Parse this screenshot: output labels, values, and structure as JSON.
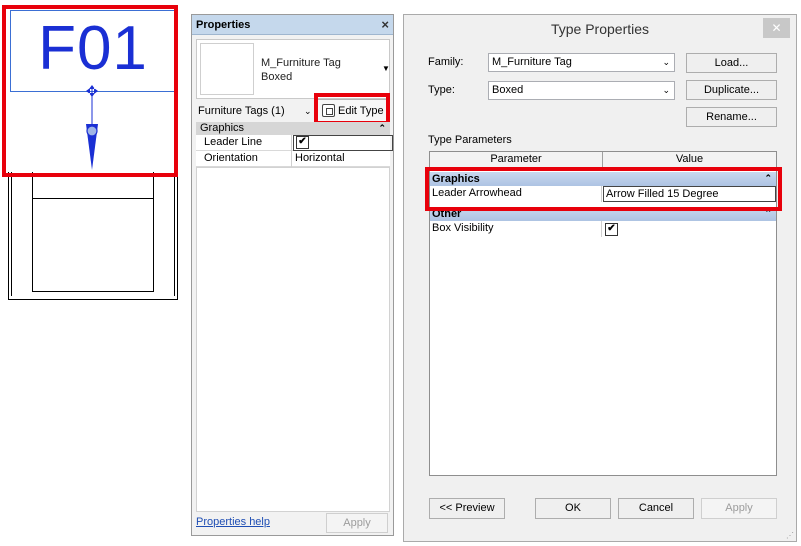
{
  "drawing": {
    "tag_text": "F01"
  },
  "properties": {
    "title": "Properties",
    "close": "×",
    "type_family": "M_Furniture Tag",
    "type_name": "Boxed",
    "filter": "Furniture Tags (1)",
    "edit_type": "Edit Type",
    "group_graphics": "Graphics",
    "rows": [
      {
        "label": "Leader Line",
        "checked": true,
        "value": "✔"
      },
      {
        "label": "Orientation",
        "value": "Horizontal"
      }
    ],
    "help_link": "Properties help",
    "apply": "Apply"
  },
  "type_properties": {
    "title": "Type Properties",
    "close": "✕",
    "family_label": "Family:",
    "family_value": "M_Furniture Tag",
    "type_label": "Type:",
    "type_value": "Boxed",
    "load": "Load...",
    "duplicate": "Duplicate...",
    "rename": "Rename...",
    "section_label": "Type Parameters",
    "col_parameter": "Parameter",
    "col_value": "Value",
    "group_graphics": "Graphics",
    "param_leader": "Leader Arrowhead",
    "value_leader": "Arrow Filled 15 Degree",
    "group_other": "Other",
    "param_box": "Box Visibility",
    "value_box": "✔",
    "preview": "<< Preview",
    "ok": "OK",
    "cancel": "Cancel",
    "apply": "Apply"
  },
  "colors": {
    "highlight": "#e8000b",
    "tag_blue": "#1a2fd4",
    "group_blue": "#adc3e3"
  }
}
